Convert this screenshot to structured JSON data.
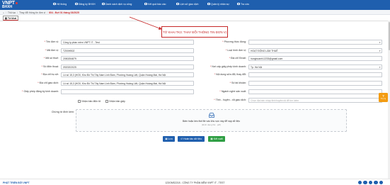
{
  "header": {
    "logo_top": "VNPT",
    "logo_bottom": "BHXH",
    "nav": [
      {
        "label": "Hệ thống",
        "icon": "grid-icon"
      },
      {
        "label": "Đăng ký BHXH",
        "icon": "form-icon"
      },
      {
        "label": "Danh sách dịch vụ công",
        "icon": "list-icon"
      },
      {
        "label": "Kết quả báo cáo",
        "icon": "chart-icon"
      },
      {
        "label": "Lịch sử giao dịch",
        "icon": "history-icon"
      },
      {
        "label": "Quản lý nhân sự",
        "icon": "people-icon"
      },
      {
        "label": "Tra cứu",
        "icon": "search-icon"
      }
    ]
  },
  "breadcrumb": {
    "home": "⌂",
    "item1": "Thủ tục",
    "item2": "Thay đổi thông tin đơn vị",
    "current": "604 - Đợt 01 tháng 03/2025"
  },
  "tab": {
    "label": "Tờ khai"
  },
  "annotation": {
    "text": "TỜ KHAI TK3: THAY ĐỔI THÔNG TIN ĐƠN VỊ"
  },
  "form": {
    "left": [
      {
        "label": "Tên đơn vị:",
        "required": "*",
        "value": "Công ty phần mềm VNPT IT - Test",
        "placeholder": false
      },
      {
        "label": "Mã đơn vị:",
        "required": "*",
        "value": "TZ00HB02",
        "placeholder": false
      },
      {
        "label": "Mã số thuế:",
        "required": "*",
        "value": "2050254879",
        "placeholder": false
      },
      {
        "label": "Số điện thoại:",
        "required": "*",
        "value": "0920202025",
        "placeholder": false
      },
      {
        "label": "Địa chỉ trụ sở:",
        "required": "*",
        "value": "Lô số 15,3 (HO0, Khu Đô Thị Tây Nam Linh Đàm, Phường Hoàng Liệt, Quận Hoàng Mai, Hà Nội",
        "placeholder": false
      },
      {
        "label": "Địa chỉ giao dịch:",
        "required": "*",
        "value": "Lô số 15,3 (HO0, Khu Đô Thị Tây Nam Linh Đàm, Phường Hoàng Liệt, Quận Hoàng Mai, Hà Nội",
        "placeholder": false
      },
      {
        "label": "Giấy phép đăng ký kinh doanh:",
        "required": "*",
        "value": "",
        "placeholder": true
      }
    ],
    "right": [
      {
        "label": "Phương thức đóng:",
        "required": "*",
        "value": "",
        "select": true
      },
      {
        "label": "Loại hình đơn vị:",
        "required": "*",
        "value": "HOẠT ĐỘNG LÀM THUÊ",
        "select": true
      },
      {
        "label": "Địa chỉ Email:",
        "required": "*",
        "value": "hunghoanh12233@gmail.com",
        "select": false
      },
      {
        "label": "Nơi cấp giấy phép kinh doanh:",
        "required": "*",
        "value": "Tp. Hà Nội",
        "select": true
      },
      {
        "label": "Nội dung sửa đổi, thay đổi:",
        "required": "*",
        "value": "",
        "select": false
      },
      {
        "label": "Số tài khoản:",
        "required": "*",
        "value": "",
        "select": false
      },
      {
        "label": "Ngành nghề sản xuất:",
        "required": "*",
        "value": "",
        "select": false
      },
      {
        "label": "Tỉnh - huyện - xã giao dịch:",
        "required": "*",
        "value": "Chọn địa bàn nhập tỉnh/huyện/xã để tìm kiếm",
        "select": true
      }
    ],
    "checkbox1": "Nhận bản điện tử",
    "checkbox2": "Nhận bản giấy",
    "attach_label": "Chứng từ đính kèm:",
    "drop_text": "Bấm hoặc kéo thả file vào khu vực này để nạp dữ liệu",
    "drop_hint": "(Định dạng file: .pdf)"
  },
  "buttons": {
    "save": "Lưu",
    "back": "Hoàn tác dữ liệu",
    "xml": "Kết xuất"
  },
  "float_button": {
    "icon": "question-icon",
    "label": "Trợ lý"
  },
  "footer": {
    "brand": "PHÁT TRIỂN BỞI VNPT",
    "company": "123GMS2218 - CÔNG TY PHẦN MỀM VNPT IT - TEST"
  },
  "colors": {
    "primary": "#1f5fae",
    "accent": "#c62828",
    "success": "#2e9e43",
    "warning": "#f39c12"
  }
}
